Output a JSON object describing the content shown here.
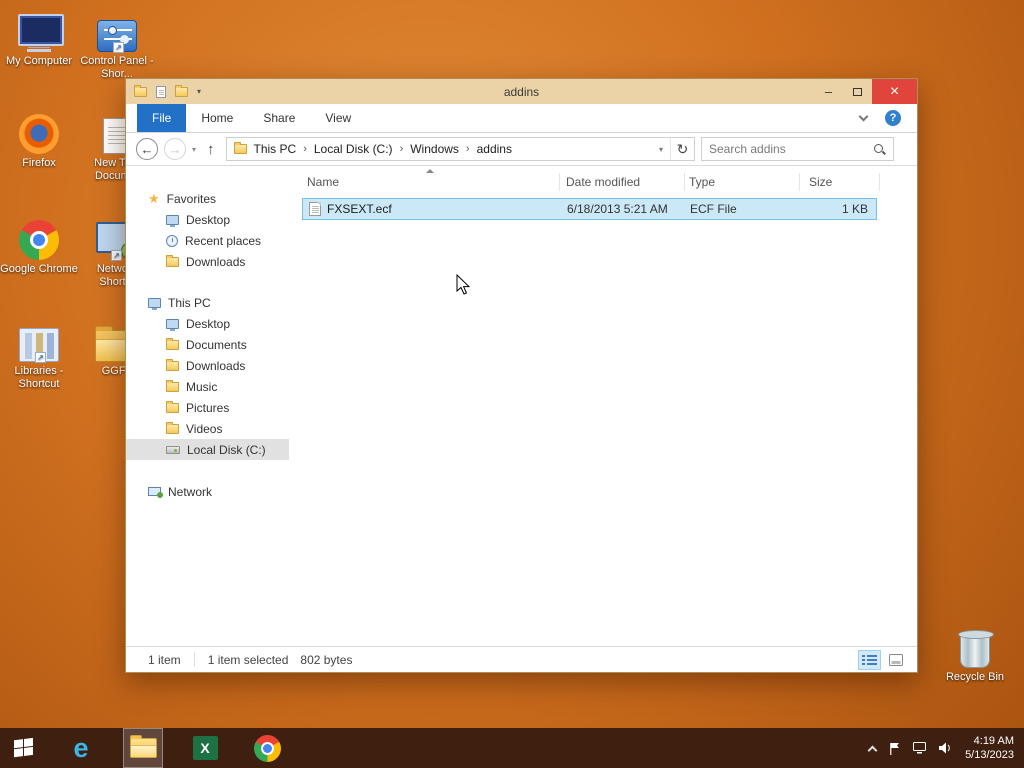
{
  "icons": {
    "minimize": "–",
    "close": "×",
    "back": "←",
    "forward": "→",
    "up": "↑",
    "refresh": "↻",
    "dropdown": "▾",
    "breadcrumb_sep": "›",
    "star": "★",
    "help": "?",
    "shortcut_arrow": "↗",
    "ie_glyph": "e",
    "excel_glyph": "X"
  },
  "colors": {
    "desktop": "#d0701f",
    "window_chrome": "#ecd3a7",
    "accent_blue": "#2271c6",
    "selection_fill": "#cbe8f6",
    "selection_border": "#77c0e8",
    "close_red": "#e0443a",
    "taskbar": "#3f1f10"
  },
  "desktop": {
    "icons": [
      {
        "label": "My Computer"
      },
      {
        "label": "Control Panel - Shor..."
      },
      {
        "label": "Firefox"
      },
      {
        "label": "New Te... Docum..."
      },
      {
        "label": "Google Chrome"
      },
      {
        "label": "Netwo... Short..."
      },
      {
        "label": "Libraries - Shortcut"
      },
      {
        "label": "GGFF"
      },
      {
        "label": "Recycle Bin"
      }
    ]
  },
  "window": {
    "title": "addins",
    "tabs": {
      "file": "File",
      "home": "Home",
      "share": "Share",
      "view": "View"
    },
    "breadcrumb": [
      "This PC",
      "Local Disk (C:)",
      "Windows",
      "addins"
    ],
    "search_placeholder": "Search addins",
    "sidebar": {
      "favorites_label": "Favorites",
      "favorites": [
        "Desktop",
        "Recent places",
        "Downloads"
      ],
      "thispc_label": "This PC",
      "thispc": [
        "Desktop",
        "Documents",
        "Downloads",
        "Music",
        "Pictures",
        "Videos",
        "Local Disk (C:)"
      ],
      "network_label": "Network"
    },
    "file_list": {
      "columns": [
        "Name",
        "Date modified",
        "Type",
        "Size"
      ],
      "rows": [
        {
          "name": "FXSEXT.ecf",
          "date_modified": "6/18/2013 5:21 AM",
          "type": "ECF File",
          "size": "1 KB"
        }
      ]
    },
    "status": {
      "items": "1 item",
      "selected": "1 item selected",
      "bytes": "802 bytes"
    }
  },
  "taskbar": {
    "clock": {
      "time": "4:19 AM",
      "date": "5/13/2023"
    }
  }
}
